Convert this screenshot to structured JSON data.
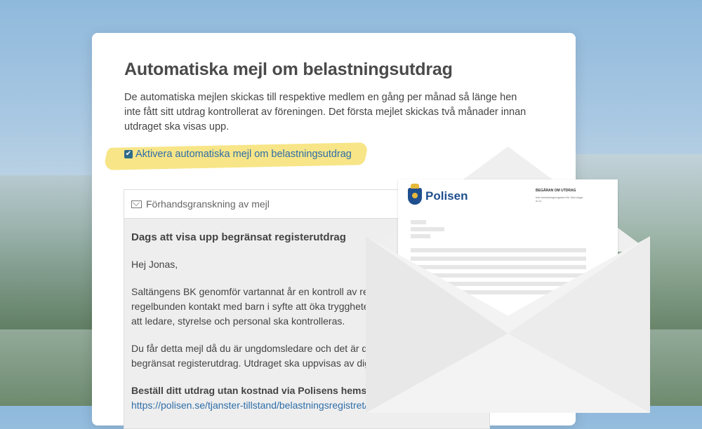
{
  "settings": {
    "title": "Automatiska mejl om belastningsutdrag",
    "description": "De automatiska mejlen skickas till respektive medlem en gång per månad  så länge hen inte fått sitt utdrag kontrollerat av föreningen. Det första mejlet skickas två månader innan utdraget ska visas upp.",
    "checkbox_label": "Aktivera automatiska mejl om belastningsutdrag",
    "checkbox_checked": true
  },
  "preview": {
    "header_label": "Förhandsgranskning av mejl",
    "subject": "Dags att visa upp begränsat registerutdrag",
    "greeting": "Hej Jonas,",
    "paragraph1": "Saltängens BK genomför vartannat år en kontroll av regist\nregelbunden kontakt med barn i syfte att öka tryggheten i\natt ledare, styrelse och personal ska kontrolleras.",
    "paragraph2": "Du får detta mejl då du är ungdomsledare och det är dags\nbegränsat registerutdrag. Utdraget ska uppvisas av dig i o",
    "order_heading": "Beställ ditt utdrag utan kostnad via Polisens hemsida",
    "order_link": "https://polisen.se/tjanster-tillstand/belastningsregistret/b"
  },
  "letter": {
    "brand": "Polisen",
    "heading": "BEGÄRAN OM UTDRAG",
    "subheading": "från belastningsregistret för föreningar m.m."
  },
  "colors": {
    "accent": "#2f6ea8",
    "highlight": "#f6e27a",
    "polisen_blue": "#1f4f8f"
  }
}
